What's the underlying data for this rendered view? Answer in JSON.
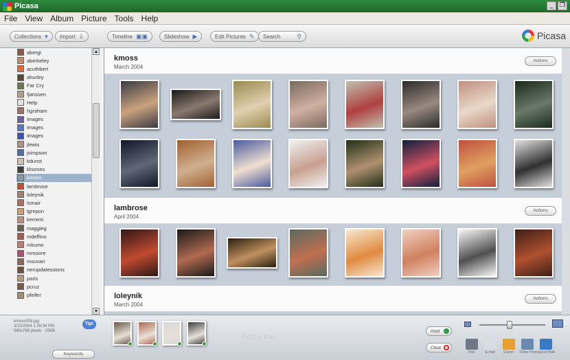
{
  "window": {
    "title": "Picasa"
  },
  "menu": [
    "File",
    "View",
    "Album",
    "Picture",
    "Tools",
    "Help"
  ],
  "toolbar": {
    "collections": "Collections",
    "import": "Import",
    "timeline": "Timeline",
    "slideshow": "Slideshow",
    "edit_pictures": "Edit Pictures",
    "search": "Search",
    "brand": "Picasa"
  },
  "folders": [
    {
      "name": "abergi",
      "color": "#8a5a44"
    },
    {
      "name": "aberkeley",
      "color": "#c48c6a"
    },
    {
      "name": "acuthbert",
      "color": "#d86c3a"
    },
    {
      "name": "ahurley",
      "color": "#5a4a3a"
    },
    {
      "name": "Far Cry",
      "color": "#6a7a4a"
    },
    {
      "name": "fjanssen",
      "color": "#b0a090"
    },
    {
      "name": "Help",
      "color": "#e0e0e0"
    },
    {
      "name": "hgraham",
      "color": "#a07060"
    },
    {
      "name": "images",
      "color": "#7060a0"
    },
    {
      "name": "images",
      "color": "#5a78b8"
    },
    {
      "name": "images",
      "color": "#3a52b8"
    },
    {
      "name": "jlewis",
      "color": "#b09080"
    },
    {
      "name": "jsimpson",
      "color": "#5070a0"
    },
    {
      "name": "kdunst",
      "color": "#d0c0b0"
    },
    {
      "name": "khomes",
      "color": "#404040"
    },
    {
      "name": "kmoss",
      "color": "#8a9aaa",
      "selected": true
    },
    {
      "name": "lambrose",
      "color": "#c05030"
    },
    {
      "name": "loleynik",
      "color": "#a08070"
    },
    {
      "name": "lsmair",
      "color": "#b07060"
    },
    {
      "name": "lgrepon",
      "color": "#d0a070"
    },
    {
      "name": "kemeni",
      "color": "#c09080"
    },
    {
      "name": "maggieg",
      "color": "#706050"
    },
    {
      "name": "mdeffino",
      "color": "#a06050"
    },
    {
      "name": "mkumo",
      "color": "#c08070"
    },
    {
      "name": "mmoore",
      "color": "#b05070"
    },
    {
      "name": "msuvari",
      "color": "#8a6a5a"
    },
    {
      "name": "nerupdatessions",
      "color": "#705040"
    },
    {
      "name": "paris",
      "color": "#b0a080"
    },
    {
      "name": "pcruz",
      "color": "#7a5a4a"
    },
    {
      "name": "pfeifer",
      "color": "#a09070"
    }
  ],
  "albums": [
    {
      "name": "kmoss",
      "date": "March 2004",
      "actions": "Actions",
      "photos": [
        {
          "c1": "#3a3a45",
          "c2": "#caa27e"
        },
        {
          "c1": "#1a1a1a",
          "c2": "#8a7a70",
          "wide": true
        },
        {
          "c1": "#9a8a50",
          "c2": "#e0d0b0"
        },
        {
          "c1": "#7a6a60",
          "c2": "#d0b0a0"
        },
        {
          "c1": "#c0c0b0",
          "c2": "#b04040"
        },
        {
          "c1": "#2a2a2a",
          "c2": "#9a8a80"
        },
        {
          "c1": "#c09080",
          "c2": "#e8d8c8"
        },
        {
          "c1": "#1a2a1a",
          "c2": "#6a7a6a"
        },
        {
          "c1": "#101828",
          "c2": "#606878"
        },
        {
          "c1": "#a06030",
          "c2": "#d0b090"
        },
        {
          "c1": "#4a5aa0",
          "c2": "#f0e0d0"
        },
        {
          "c1": "#f0f0f0",
          "c2": "#c8a090"
        },
        {
          "c1": "#203018",
          "c2": "#b09070"
        },
        {
          "c1": "#102040",
          "c2": "#d05060"
        },
        {
          "c1": "#c05040",
          "c2": "#e0a060"
        },
        {
          "c1": "#e0e0e0",
          "c2": "#303030"
        }
      ]
    },
    {
      "name": "lambrose",
      "date": "April 2004",
      "actions": "Actions",
      "photos": [
        {
          "c1": "#301818",
          "c2": "#c04a30"
        },
        {
          "c1": "#1a1a1a",
          "c2": "#b06a50"
        },
        {
          "c1": "#2a2010",
          "c2": "#c09060",
          "wide": true
        },
        {
          "c1": "#5a6a60",
          "c2": "#c07050"
        },
        {
          "c1": "#f8e8d0",
          "c2": "#e08a40"
        },
        {
          "c1": "#f0d0c0",
          "c2": "#d08060"
        },
        {
          "c1": "#f8f8f8",
          "c2": "#505050"
        },
        {
          "c1": "#402018",
          "c2": "#b05030"
        }
      ]
    },
    {
      "name": "loleynik",
      "date": "March 2004",
      "actions": "Actions",
      "photos": []
    }
  ],
  "status": {
    "file": "kmoss008.jpg",
    "datetime": "3/23/2004 1:26:34 PM",
    "dimensions": "580x768 pixels · 20KB",
    "tip": "Tip!",
    "keywords": "Keywords"
  },
  "tray": {
    "placeholder": "Picture Tray",
    "hold": "Hold",
    "clear": "Clear",
    "photos": [
      "#6a5a4a",
      "#b06a50",
      "#d8d8d8",
      "#404040"
    ]
  },
  "actions": [
    {
      "label": "Print",
      "icon": "printer-icon",
      "color": "#707888"
    },
    {
      "label": "E-mail",
      "icon": "email-icon",
      "color": "#d8dce4"
    },
    {
      "label": "Export",
      "icon": "export-folder-icon",
      "color": "#e8a030"
    },
    {
      "label": "Order Prints",
      "icon": "order-prints-icon",
      "color": "#6a8ab0"
    },
    {
      "label": "Send Hello",
      "icon": "hello-icon",
      "color": "#3a78c8"
    }
  ],
  "zoom": {
    "level": 0.45
  }
}
